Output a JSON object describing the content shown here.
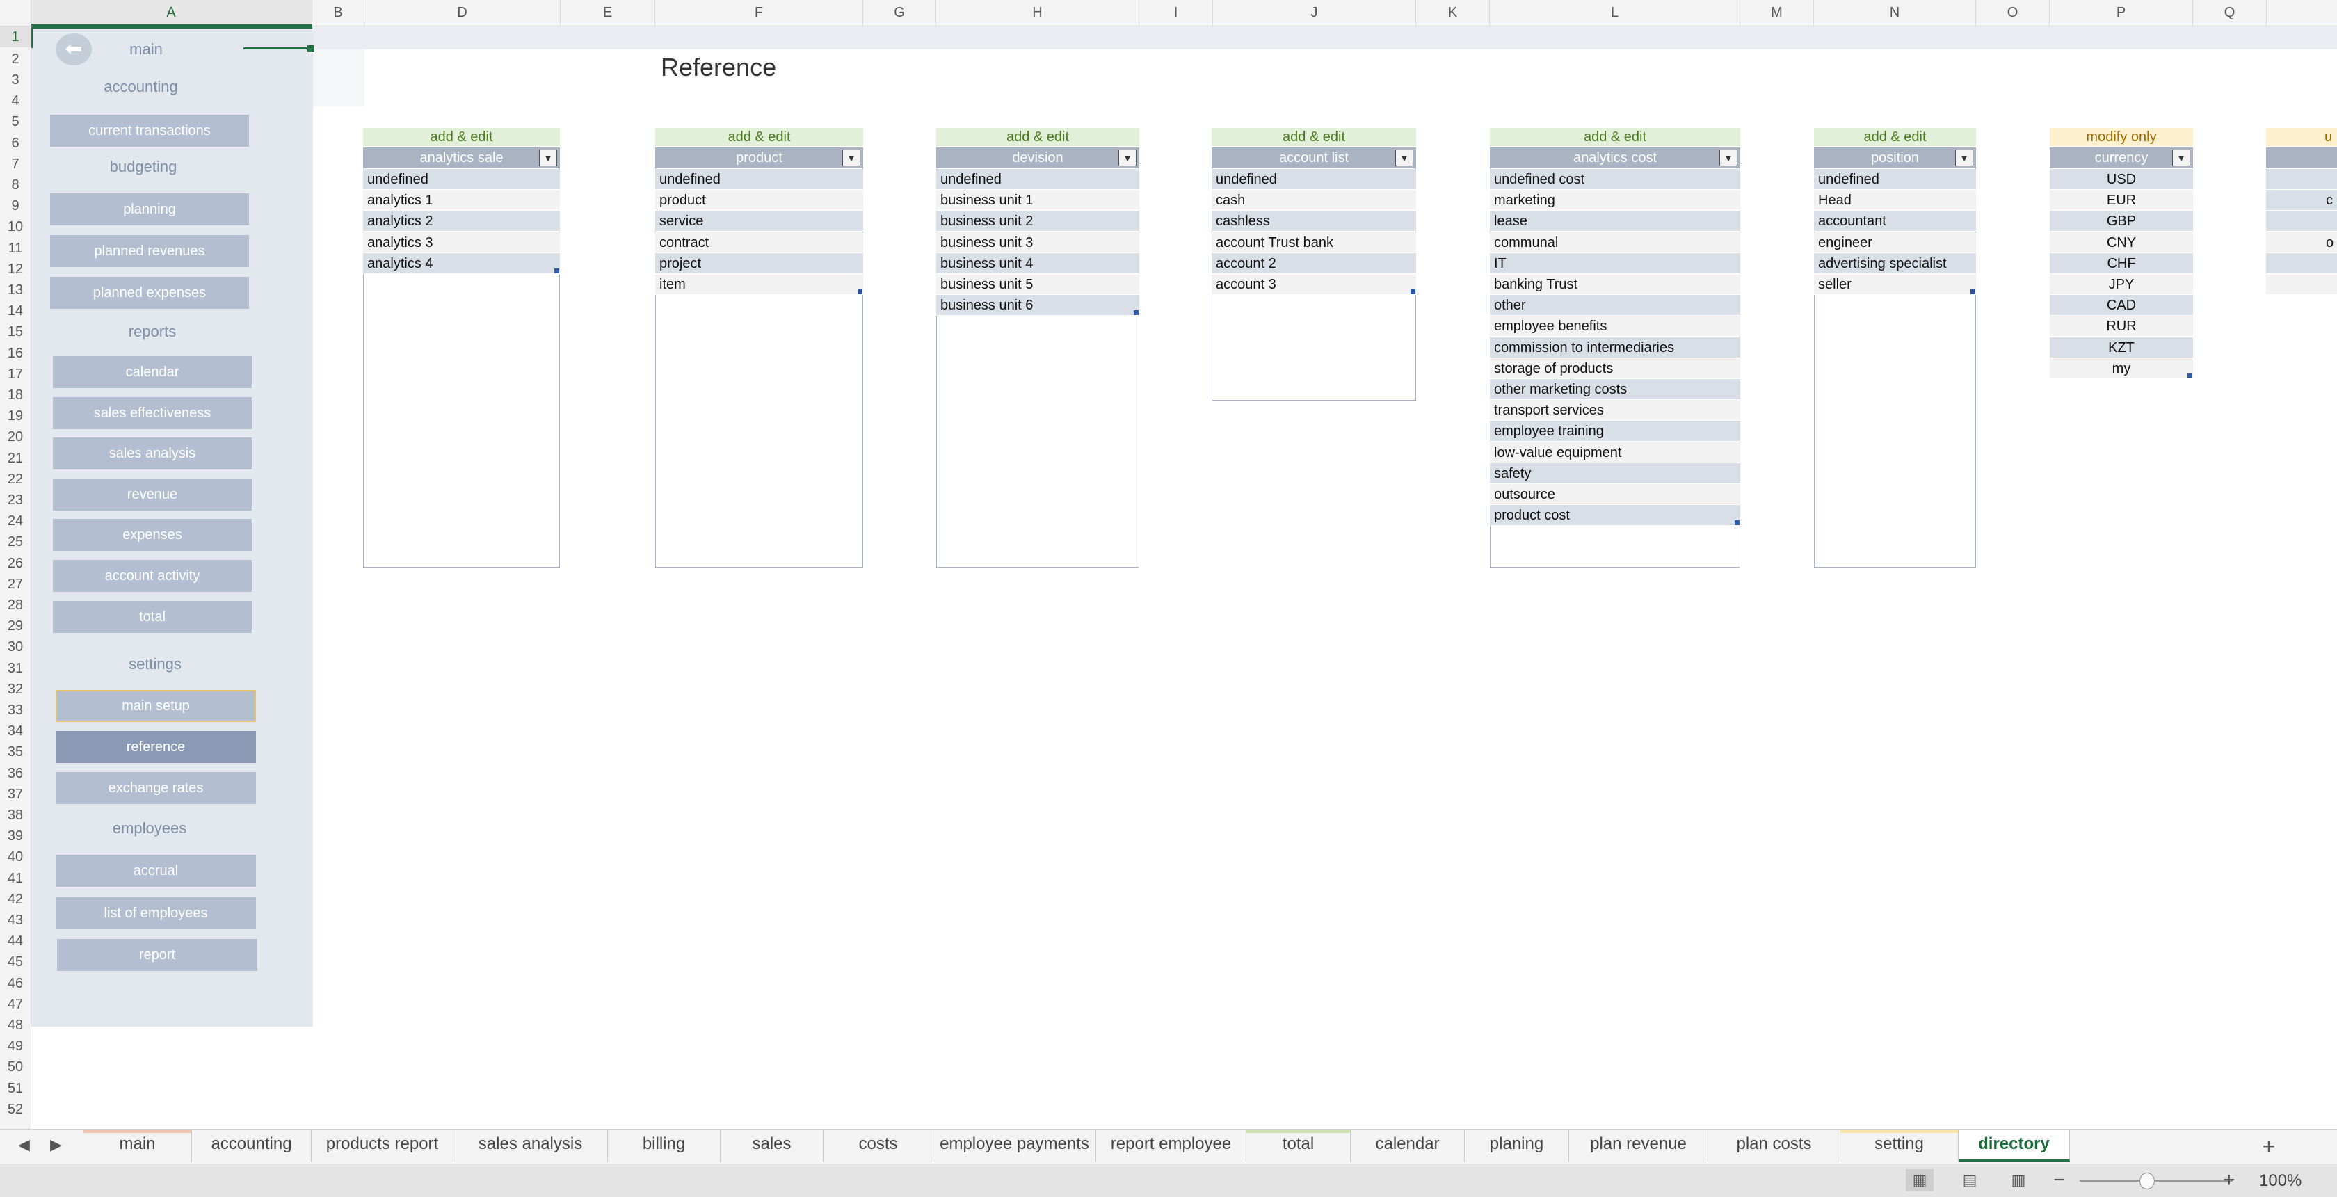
{
  "columns": [
    "A",
    "B",
    "D",
    "E",
    "F",
    "G",
    "H",
    "I",
    "J",
    "K",
    "L",
    "M",
    "N",
    "O",
    "P",
    "Q"
  ],
  "rows": [
    "1",
    "2",
    "3",
    "4",
    "5",
    "6",
    "7",
    "8",
    "9",
    "10",
    "11",
    "12",
    "13",
    "14",
    "15",
    "16",
    "17",
    "18",
    "19",
    "20",
    "21",
    "22",
    "23",
    "24",
    "25",
    "26",
    "27",
    "28",
    "29",
    "30",
    "31",
    "32",
    "33",
    "34",
    "35",
    "36",
    "37",
    "38",
    "39",
    "40",
    "41",
    "42",
    "43",
    "44",
    "45",
    "46",
    "47",
    "48",
    "49",
    "50",
    "51",
    "52"
  ],
  "sidebar": {
    "back_icon": "arrow-left-icon",
    "main": "main",
    "accounting_head": "accounting",
    "current_transactions": "current transactions",
    "budgeting_head": "budgeting",
    "planning": "planning",
    "planned_revenues": "planned revenues",
    "planned_expenses": "planned expenses",
    "reports_head": "reports",
    "calendar": "calendar",
    "sales_effectiveness": "sales effectiveness",
    "sales_analysis": "sales analysis",
    "revenue": "revenue",
    "expenses": "expenses",
    "account_activity": "account activity",
    "total": "total",
    "settings_head": "settings",
    "main_setup": "main setup",
    "reference": "reference",
    "exchange_rates": "exchange rates",
    "employees_head": "employees",
    "accrual": "accrual",
    "list_of_employees": "list of employees",
    "report": "report"
  },
  "page": {
    "title": "Reference"
  },
  "tables": {
    "t1": {
      "tag": "add & edit",
      "header": "analytics sale",
      "rows": [
        "undefined",
        "analytics 1",
        "analytics 2",
        "analytics 3",
        "analytics 4"
      ]
    },
    "t2": {
      "tag": "add & edit",
      "header": "product",
      "rows": [
        "undefined",
        "product",
        "service",
        "contract",
        "project",
        "item"
      ]
    },
    "t3": {
      "tag": "add & edit",
      "header": "devision",
      "rows": [
        "undefined",
        "business unit 1",
        "business unit 2",
        "business unit 3",
        "business unit 4",
        "business unit 5",
        "business unit 6"
      ]
    },
    "t4": {
      "tag": "add & edit",
      "header": "account list",
      "rows": [
        "undefined",
        "cash",
        "cashless",
        "account Trust bank",
        "account 2",
        "account 3"
      ]
    },
    "t5": {
      "tag": "add & edit",
      "header": "analytics cost",
      "rows": [
        "undefined cost",
        "marketing",
        "lease",
        "communal",
        "IT",
        "banking Trust",
        "other",
        "employee benefits",
        "commission to intermediaries",
        "storage of products",
        "other marketing costs",
        "transport services",
        "employee training",
        "low-value equipment",
        "safety",
        "outsource",
        "product cost"
      ]
    },
    "t6": {
      "tag": "add & edit",
      "header": "position",
      "rows": [
        "undefined",
        "Head",
        "accountant",
        "engineer",
        "advertising specialist",
        "seller"
      ]
    },
    "t7": {
      "tag": "modify only",
      "header": "currency",
      "rows": [
        "USD",
        "EUR",
        "GBP",
        "CNY",
        "CHF",
        "JPY",
        "CAD",
        "RUR",
        "KZT",
        "my"
      ]
    },
    "t8": {
      "tag": "u",
      "rows": [
        "c",
        "o"
      ]
    }
  },
  "dropdown_icon": "dropdown-arrow-icon",
  "sheet_tabs": [
    "main",
    "accounting",
    "products report",
    "sales analysis",
    "billing",
    "sales",
    "costs",
    "employee payments",
    "report employee",
    "total",
    "calendar",
    "planing",
    "plan revenue",
    "plan costs",
    "setting",
    "directory"
  ],
  "active_tab": "directory",
  "status": {
    "zoom": "100%",
    "zoom_minus": "−",
    "zoom_plus": "+"
  },
  "colors": {
    "accent": "#217346",
    "sidebar_bg": "#e3e8ee",
    "button": "#b3bfd0",
    "button_active": "#8a9ab4",
    "table_header": "#a9b3c1",
    "tag_green": "#e2efd9",
    "tag_yellow": "#fdf0cf"
  }
}
